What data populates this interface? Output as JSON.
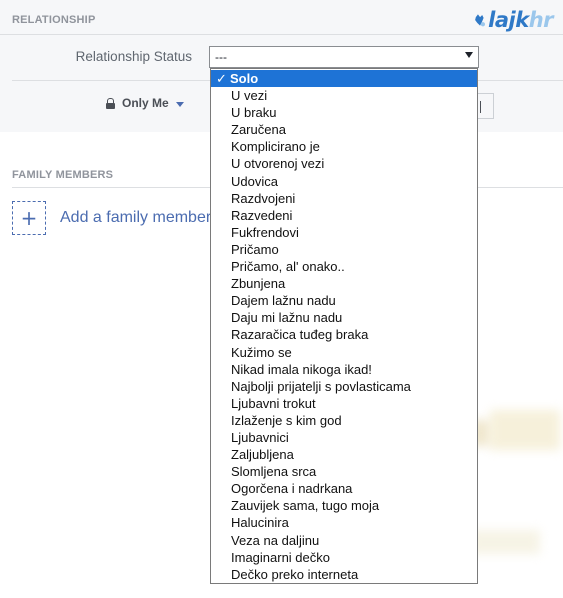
{
  "relationship_section": {
    "heading": "RELATIONSHIP",
    "status_label": "Relationship Status",
    "select_value": "---",
    "privacy_label": "Only Me"
  },
  "logo": {
    "text_main": "lajk",
    "text_accent": "hr",
    "color": "#2f79c7"
  },
  "family_section": {
    "heading": "FAMILY MEMBERS",
    "add_label": "Add a family member",
    "plus_symbol": "+"
  },
  "dropdown": {
    "selected_index": 0,
    "check_mark": "✓",
    "highlight_color": "#1e73d6",
    "options": [
      "Solo",
      "U vezi",
      "U braku",
      "Zaručena",
      "Komplicirano je",
      "U otvorenoj vezi",
      "Udovica",
      "Razdvojeni",
      "Razvedeni",
      "Fukfrendovi",
      "Pričamo",
      "Pričamo, al' onako..",
      "Zbunjena",
      "Dajem lažnu nadu",
      "Daju mi lažnu nadu",
      "Razaračica tuđeg braka",
      "Kužimo se",
      "Nikad imala nikoga ikad!",
      "Najbolji prijatelji s povlasticama",
      "Ljubavni trokut",
      "Izlaženje s kim god",
      "Ljubavnici",
      "Zaljubljena",
      "Slomljena srca",
      "Ogorčena i nadrkana",
      "Zauvijek sama, tugo moja",
      "Halucinira",
      "Veza na daljinu",
      "Imaginarni dečko",
      "Dečko preko interneta"
    ]
  }
}
